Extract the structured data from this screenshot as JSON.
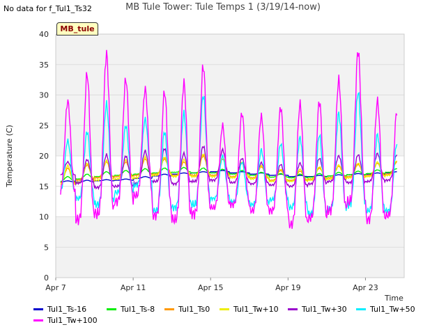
{
  "header": {
    "nodata_note": "No data for f_Tul1_Ts32",
    "site_badge": "MB_tule"
  },
  "chart_data": {
    "type": "line",
    "title": "MB Tule Tower: Tule Temps 1 (3/19/14-now)",
    "xlabel": "Time",
    "ylabel": "Temperature (C)",
    "ylim": [
      0,
      40
    ],
    "yticks": [
      0,
      5,
      10,
      15,
      20,
      25,
      30,
      35,
      40
    ],
    "xlim": [
      "2014-04-07",
      "2014-04-25"
    ],
    "xticks": [
      "Apr 7",
      "Apr 11",
      "Apr 15",
      "Apr 19",
      "Apr 23"
    ],
    "grid": true,
    "legend_position": "bottom",
    "x_days": [
      "Apr 7",
      "Apr 8",
      "Apr 9",
      "Apr 10",
      "Apr 11",
      "Apr 12",
      "Apr 13",
      "Apr 14",
      "Apr 15",
      "Apr 16",
      "Apr 17",
      "Apr 18",
      "Apr 19",
      "Apr 20",
      "Apr 21",
      "Apr 22",
      "Apr 23",
      "Apr 24"
    ],
    "series": [
      {
        "name": "Tul1_Ts-16",
        "color": "#0000cc",
        "daily_min": [
          15.7,
          15.7,
          15.9,
          16.0,
          16.3,
          16.7,
          17.0,
          17.2,
          17.4,
          17.2,
          17.0,
          16.8,
          16.6,
          16.6,
          16.7,
          16.9,
          17.0,
          17.2
        ],
        "daily_max": [
          15.9,
          16.0,
          16.1,
          16.2,
          16.6,
          17.0,
          17.2,
          17.4,
          17.6,
          17.4,
          17.2,
          17.0,
          16.8,
          16.8,
          16.9,
          17.1,
          17.2,
          17.4
        ]
      },
      {
        "name": "Tul1_Ts-8",
        "color": "#00ee00",
        "daily_min": [
          15.8,
          16.2,
          16.6,
          16.8,
          17.0,
          17.2,
          17.3,
          17.2,
          17.2,
          17.0,
          16.8,
          16.5,
          16.4,
          16.5,
          16.7,
          16.9,
          17.1,
          17.3
        ],
        "daily_max": [
          16.6,
          17.0,
          17.4,
          17.6,
          17.9,
          18.0,
          18.1,
          18.0,
          17.8,
          17.6,
          17.3,
          17.1,
          17.0,
          17.1,
          17.3,
          17.5,
          17.7,
          17.9
        ]
      },
      {
        "name": "Tul1_Ts0",
        "color": "#ff9900",
        "daily_min": [
          15.5,
          16.0,
          16.4,
          16.6,
          16.8,
          17.0,
          16.8,
          16.8,
          16.8,
          16.6,
          16.4,
          16.0,
          16.0,
          16.2,
          16.4,
          16.6,
          16.8,
          17.0
        ],
        "daily_max": [
          18.0,
          18.5,
          19.0,
          19.0,
          19.5,
          19.5,
          19.0,
          20.0,
          19.5,
          18.8,
          18.2,
          17.6,
          17.5,
          18.0,
          18.3,
          18.6,
          18.8,
          19.0
        ]
      },
      {
        "name": "Tul1_Tw+10",
        "color": "#eeee00",
        "daily_min": [
          15.2,
          15.6,
          16.0,
          16.2,
          16.4,
          16.8,
          16.6,
          16.6,
          16.6,
          16.4,
          16.2,
          15.8,
          15.8,
          16.0,
          16.2,
          16.4,
          16.6,
          16.8
        ],
        "daily_max": [
          18.4,
          18.8,
          19.2,
          19.4,
          19.8,
          19.8,
          19.4,
          20.3,
          19.8,
          19.0,
          18.4,
          17.8,
          17.8,
          18.2,
          18.5,
          18.8,
          19.0,
          19.2
        ]
      },
      {
        "name": "Tul1_Tw+30",
        "color": "#9900cc",
        "daily_min": [
          16.8,
          15.5,
          14.8,
          15.0,
          15.5,
          15.8,
          15.4,
          15.8,
          16.0,
          15.6,
          15.4,
          15.2,
          15.0,
          15.4,
          15.8,
          15.6,
          15.8,
          16.0
        ],
        "daily_max": [
          19.0,
          19.4,
          20.2,
          20.0,
          20.8,
          21.2,
          20.4,
          21.6,
          21.0,
          19.6,
          18.9,
          18.6,
          18.8,
          19.6,
          20.0,
          20.2,
          20.4,
          20.2
        ]
      },
      {
        "name": "Tul1_Tw+50",
        "color": "#00eeff",
        "daily_min": [
          14.0,
          13.0,
          12.0,
          14.0,
          15.2,
          11.0,
          11.5,
          12.0,
          13.0,
          12.5,
          12.0,
          12.8,
          11.5,
          10.5,
          11.2,
          12.0,
          11.0,
          11.0
        ],
        "daily_max": [
          22.5,
          24.0,
          28.5,
          25.0,
          26.0,
          24.0,
          27.0,
          30.0,
          20.0,
          19.0,
          21.0,
          22.0,
          23.0,
          23.5,
          27.0,
          30.5,
          23.5,
          22.0
        ]
      },
      {
        "name": "Tul1_Tw+100",
        "color": "#ff00ff",
        "daily_min": [
          13.8,
          9.5,
          10.5,
          12.5,
          13.5,
          10.2,
          9.5,
          10.5,
          11.5,
          12.0,
          11.0,
          11.0,
          8.7,
          9.8,
          11.0,
          12.5,
          9.5,
          10.2
        ],
        "daily_max": [
          29.0,
          33.5,
          36.8,
          32.6,
          31.0,
          30.5,
          32.0,
          34.8,
          25.0,
          27.0,
          26.5,
          28.0,
          28.5,
          29.0,
          32.5,
          37.3,
          29.0,
          27.3
        ]
      }
    ]
  }
}
